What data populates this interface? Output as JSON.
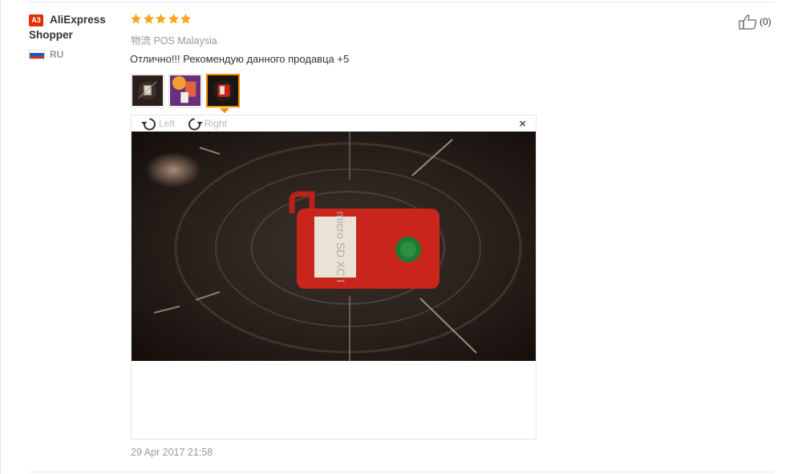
{
  "review": {
    "user": {
      "badge": "A3",
      "name_line1": "AliExpress",
      "name_line2": "Shopper",
      "country_code": "RU"
    },
    "rating": 5,
    "logistics_label": "物流",
    "logistics_value": "POS Malaysia",
    "text": "Отлично!!! Рекомендую данного продавца +5",
    "thumbnails": [
      "photo-1",
      "photo-2",
      "photo-3"
    ],
    "active_thumbnail": 2,
    "viewer": {
      "rotate_left": "Left",
      "rotate_right": "Right",
      "close": "×"
    },
    "date": "29 Apr 2017 21:58",
    "useful_count": "(0)"
  },
  "colors": {
    "star": "#f7a51c",
    "badge": "#e62e04",
    "active_border": "#f28c00",
    "muted_text": "#999999"
  },
  "icons": {
    "rotate_left": "rotate-left-icon",
    "rotate_right": "rotate-right-icon",
    "thumbs_up": "thumbs-up-icon",
    "close": "close-icon",
    "flag": "russia-flag-icon"
  }
}
